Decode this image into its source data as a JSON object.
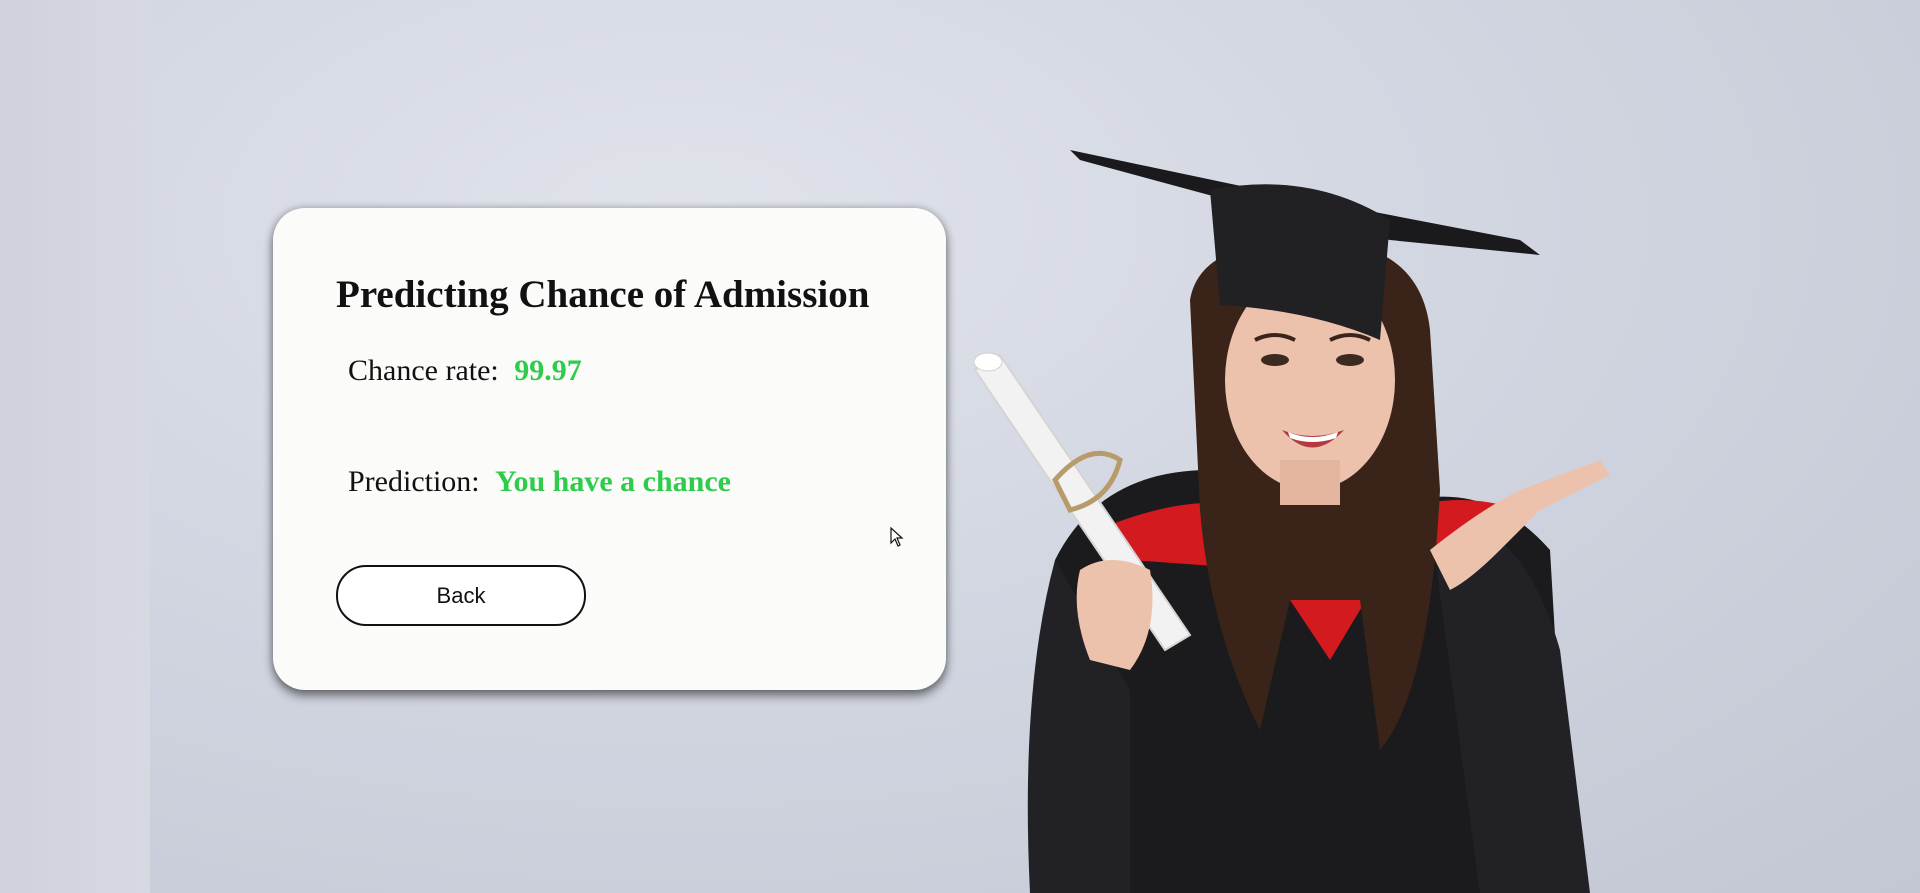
{
  "card": {
    "title": "Predicting Chance of Admission",
    "rate_label": "Chance rate:",
    "rate_value": "99.97",
    "prediction_label": "Prediction:",
    "prediction_value": "You have a chance",
    "back_label": "Back"
  },
  "colors": {
    "accent_green": "#2ecc4a",
    "card_background": "#fbfbfa",
    "page_background": "#d2d6e1"
  },
  "background_image": {
    "subject": "graduate-holding-diploma"
  }
}
